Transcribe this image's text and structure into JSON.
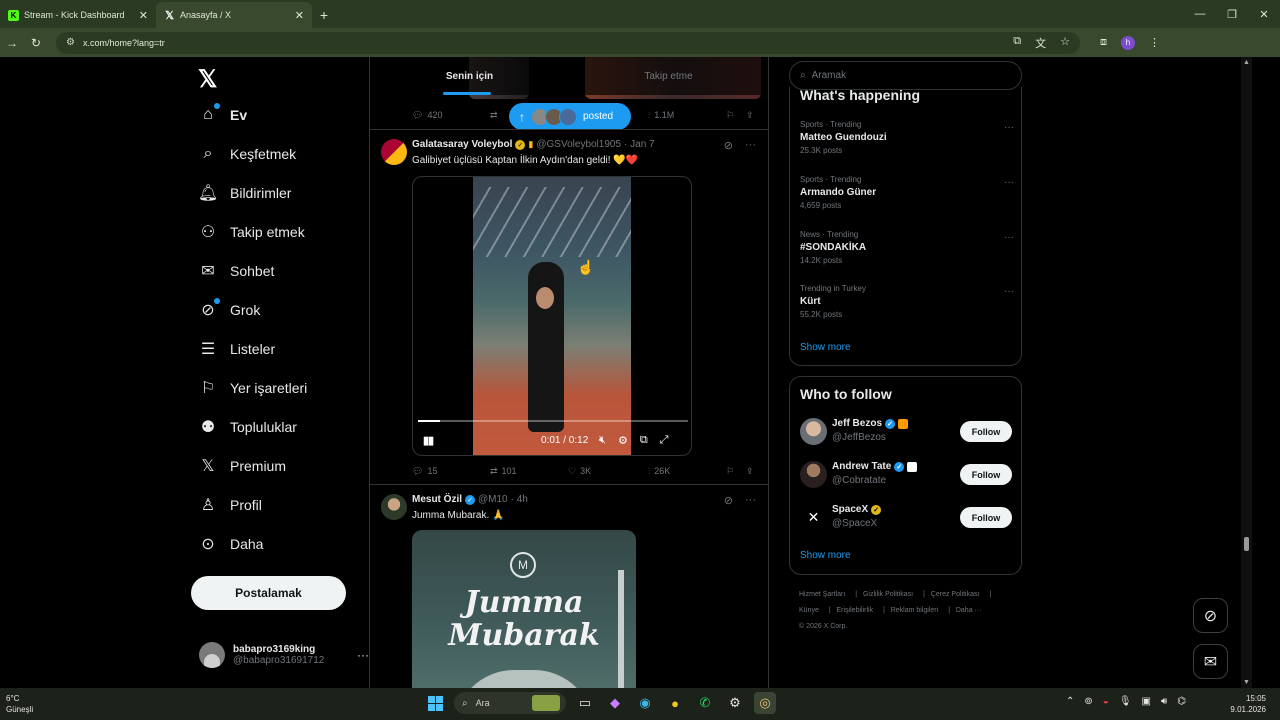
{
  "browser": {
    "tabs": [
      {
        "title": "Stream - Kick Dashboard",
        "active": false
      },
      {
        "title": "Anasayfa / X",
        "active": true
      }
    ],
    "url": "x.com/home?lang=tr"
  },
  "nav": {
    "items": [
      {
        "label": "Ev",
        "icon": "home-icon",
        "active": true
      },
      {
        "label": "Keşfetmek",
        "icon": "search-icon"
      },
      {
        "label": "Bildirimler",
        "icon": "bell-icon"
      },
      {
        "label": "Takip etmek",
        "icon": "person-add-icon"
      },
      {
        "label": "Sohbet",
        "icon": "mail-icon"
      },
      {
        "label": "Grok",
        "icon": "grok-icon"
      },
      {
        "label": "Listeler",
        "icon": "list-icon"
      },
      {
        "label": "Yer işaretleri",
        "icon": "bookmark-icon"
      },
      {
        "label": "Topluluklar",
        "icon": "communities-icon"
      },
      {
        "label": "Premium",
        "icon": "x-premium-icon"
      },
      {
        "label": "Profil",
        "icon": "profile-icon"
      },
      {
        "label": "Daha",
        "icon": "more-circle-icon"
      }
    ],
    "post_button": "Postalamak",
    "account": {
      "name": "babapro3169king",
      "handle": "@babapro31691712"
    }
  },
  "timeline": {
    "tabs": [
      "Senin için",
      "Takip etme"
    ],
    "top_actions": {
      "replies": "420",
      "views": "1.1M"
    },
    "posted_pill": "posted",
    "tweets": [
      {
        "name": "Galatasaray Voleybol",
        "handle": "@GSVoleybol1905",
        "time": "· Jan 7",
        "text": "Galibiyet üçlüsü Kaptan İlkin Aydın'dan geldi! 💛❤️",
        "video_time": "0:01 / 0:12",
        "video_progress": 0.08,
        "stats": {
          "replies": "15",
          "reposts": "101",
          "likes": "3K",
          "views": "26K"
        }
      },
      {
        "name": "Mesut Özil",
        "handle": "@M10",
        "time": "· 4h",
        "text": "Jumma Mubarak. 🙏",
        "image_text": [
          "Jumma",
          "Mubarak"
        ]
      }
    ]
  },
  "right": {
    "search_placeholder": "Aramak",
    "trending_title": "What's happening",
    "trends": [
      {
        "meta": "Sports · Trending",
        "title": "Matteo Guendouzi",
        "count": "25.3K posts"
      },
      {
        "meta": "Sports · Trending",
        "title": "Armando Güner",
        "count": "4,659 posts"
      },
      {
        "meta": "News · Trending",
        "title": "#SONDAKİKA",
        "count": "14.2K posts"
      },
      {
        "meta": "Trending in Turkey",
        "title": "Kürt",
        "count": "55.2K posts"
      }
    ],
    "show_more": "Show more",
    "who_to_follow_title": "Who to follow",
    "follow_label": "Follow",
    "suggestions": [
      {
        "name": "Jeff Bezos",
        "handle": "@JeffBezos"
      },
      {
        "name": "Andrew Tate",
        "handle": "@Cobratate"
      },
      {
        "name": "SpaceX",
        "handle": "@SpaceX"
      }
    ],
    "footer": [
      "Hizmet Şartları",
      "Gizlilik Politikası",
      "Çerez Politikası",
      "Künye",
      "Erişilebilirlik",
      "Reklam bilgileri",
      "Daha ···",
      "© 2026 X Corp."
    ]
  },
  "taskbar": {
    "temp": "6°C",
    "weather": "Güneşli",
    "search": "Ara",
    "time": "15:05",
    "date": "9.01.2026"
  },
  "colors": {
    "accent": "#1d9bf0",
    "chrome": "#2b3a22",
    "verified_gold": "#e2b719"
  }
}
